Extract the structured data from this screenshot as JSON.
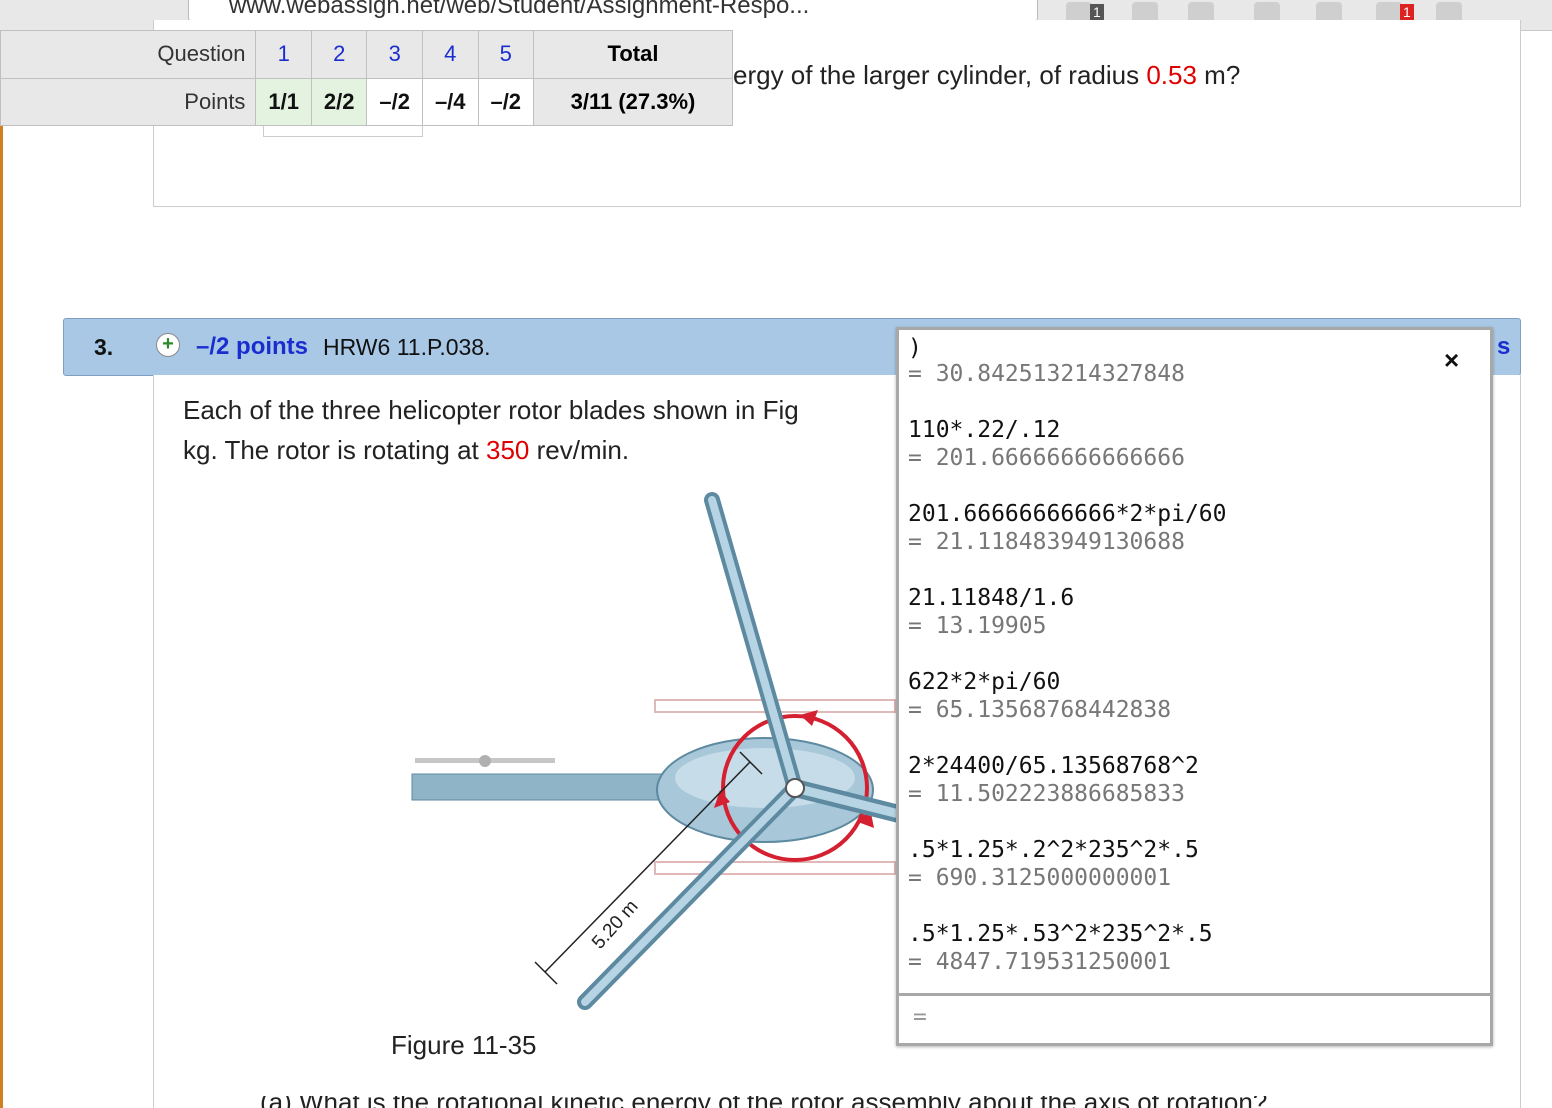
{
  "browser": {
    "url_fragment": "www.webassign.net/web/Student/Assignment-Respo...",
    "badge_1": "1",
    "badge_2": "1"
  },
  "score_table": {
    "question_label": "Question",
    "points_label": "Points",
    "total_label": "Total",
    "questions": [
      "1",
      "2",
      "3",
      "4",
      "5"
    ],
    "points": [
      "1/1",
      "2/2",
      "–/2",
      "–/4",
      "–/2"
    ],
    "total": "3/11 (27.3%)"
  },
  "prev_question": {
    "text_before": "ergy of the larger cylinder, of radius ",
    "radius_value": "0.53",
    "text_after": " m?"
  },
  "question3": {
    "number": "3.",
    "points": "–/2 points",
    "code": "HRW6 11.P.038.",
    "clipped_link": "s",
    "line1": "Each of the three helicopter rotor blades shown in Fig",
    "line2_before": "kg. The rotor is rotating at ",
    "rpm_value": "350",
    "line2_after": " rev/min.",
    "figure_caption": "Figure 11-35",
    "blade_length_label": "5.20 m",
    "next_part_clipped": "(a) What is the rotational kinetic energy of the rotor assembly about the axis of rotation?"
  },
  "calculator": {
    "close_label": "×",
    "top_fragment": ")",
    "first_result": "= 30.842513214327848",
    "entries": [
      {
        "expr": "110*.22/.12",
        "result": "= 201.66666666666666"
      },
      {
        "expr": "201.66666666666*2*pi/60",
        "result": "= 21.118483949130688"
      },
      {
        "expr": "21.11848/1.6",
        "result": "= 13.19905"
      },
      {
        "expr": "622*2*pi/60",
        "result": "= 65.13568768442838"
      },
      {
        "expr": "2*24400/65.13568768^2",
        "result": "= 11.502223886685833"
      },
      {
        "expr": ".5*1.25*.2^2*235^2*.5",
        "result": "= 690.3125000000001"
      },
      {
        "expr": ".5*1.25*.53^2*235^2*.5",
        "result": "= 4847.719531250001"
      }
    ],
    "input_prefix": "="
  },
  "colors": {
    "accent_blue": "#1a2ed0",
    "highlight_red": "#e00000",
    "question_bar": "#a9c8e5"
  }
}
